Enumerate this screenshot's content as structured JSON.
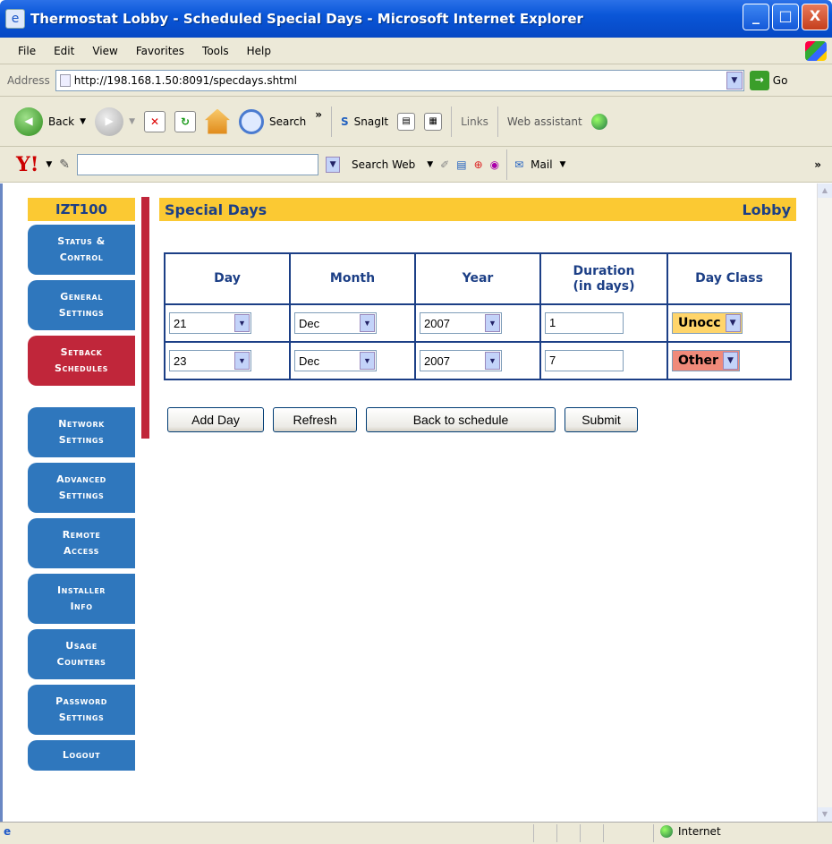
{
  "window": {
    "title": "Thermostat Lobby - Scheduled Special Days - Microsoft Internet Explorer",
    "minimize": "_",
    "maximize": "□",
    "close": "X"
  },
  "menu": [
    "File",
    "Edit",
    "View",
    "Favorites",
    "Tools",
    "Help"
  ],
  "address": {
    "label": "Address",
    "url": "http://198.168.1.50:8091/specdays.shtml",
    "go": "Go"
  },
  "toolbar": {
    "back": "Back",
    "search": "Search",
    "more": "»",
    "snagit": "SnagIt",
    "links": "Links",
    "web_assistant": "Web assistant"
  },
  "yahoo": {
    "logo": "Y!",
    "search_web": "Search Web",
    "mail": "Mail",
    "more": "»"
  },
  "sidebar": {
    "brand": "IZT100",
    "items": [
      {
        "line1": "Status &",
        "line2": "Control"
      },
      {
        "line1": "General",
        "line2": "Settings"
      },
      {
        "line1": "Setback",
        "line2": "Schedules"
      },
      {
        "line1": "Network",
        "line2": "Settings"
      },
      {
        "line1": "Advanced",
        "line2": "Settings"
      },
      {
        "line1": "Remote",
        "line2": "Access"
      },
      {
        "line1": "Installer",
        "line2": "Info"
      },
      {
        "line1": "Usage",
        "line2": "Counters"
      },
      {
        "line1": "Password",
        "line2": "Settings"
      },
      {
        "line1": "Logout"
      }
    ]
  },
  "header": {
    "title": "Special Days",
    "location": "Lobby"
  },
  "table": {
    "columns": [
      "Day",
      "Month",
      "Year",
      "Duration",
      "(in days)",
      "Day Class"
    ],
    "rows": [
      {
        "day": "21",
        "month": "Dec",
        "year": "2007",
        "duration": "1",
        "day_class": "Unocc"
      },
      {
        "day": "23",
        "month": "Dec",
        "year": "2007",
        "duration": "7",
        "day_class": "Other"
      }
    ]
  },
  "actions": {
    "add_day": "Add Day",
    "refresh": "Refresh",
    "back": "Back to schedule",
    "submit": "Submit"
  },
  "status": {
    "zone": "Internet"
  },
  "colors": {
    "accent_yellow": "#fbc933",
    "nav_blue": "#2f77bd",
    "nav_active": "#c0263a",
    "heading": "#1c3f86"
  }
}
